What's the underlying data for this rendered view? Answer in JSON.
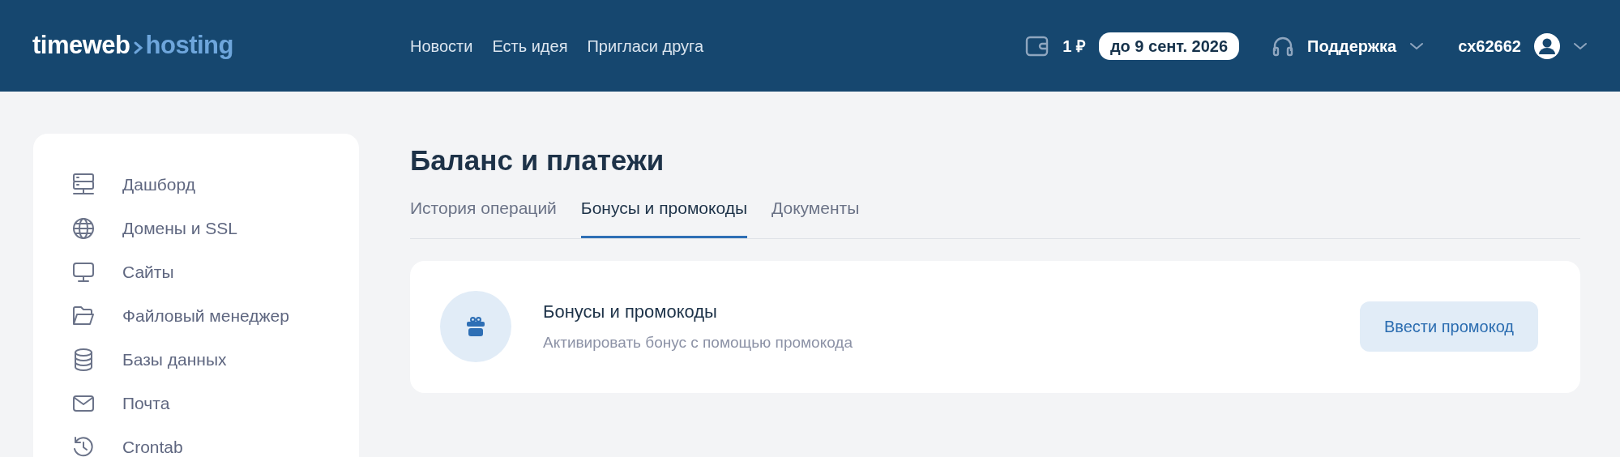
{
  "header": {
    "logo": {
      "primary": "timeweb",
      "secondary": "hosting"
    },
    "nav_links": [
      "Новости",
      "Есть идея",
      "Пригласи друга"
    ],
    "balance": "1 ₽",
    "balance_badge": "до 9 сент. 2026",
    "support": "Поддержка",
    "user": "cx62662"
  },
  "sidebar": {
    "items": [
      {
        "label": "Дашборд"
      },
      {
        "label": "Домены и SSL"
      },
      {
        "label": "Сайты"
      },
      {
        "label": "Файловый менеджер"
      },
      {
        "label": "Базы данных"
      },
      {
        "label": "Почта"
      },
      {
        "label": "Crontab"
      }
    ]
  },
  "page": {
    "title": "Баланс и платежи",
    "tabs": [
      {
        "label": "История операций",
        "selected": false
      },
      {
        "label": "Бонусы и промокоды",
        "selected": true
      },
      {
        "label": "Документы",
        "selected": false
      }
    ],
    "card": {
      "title": "Бонусы и промокоды",
      "subtitle": "Активировать бонус с помощью промокода",
      "button": "Ввести промокод"
    }
  }
}
